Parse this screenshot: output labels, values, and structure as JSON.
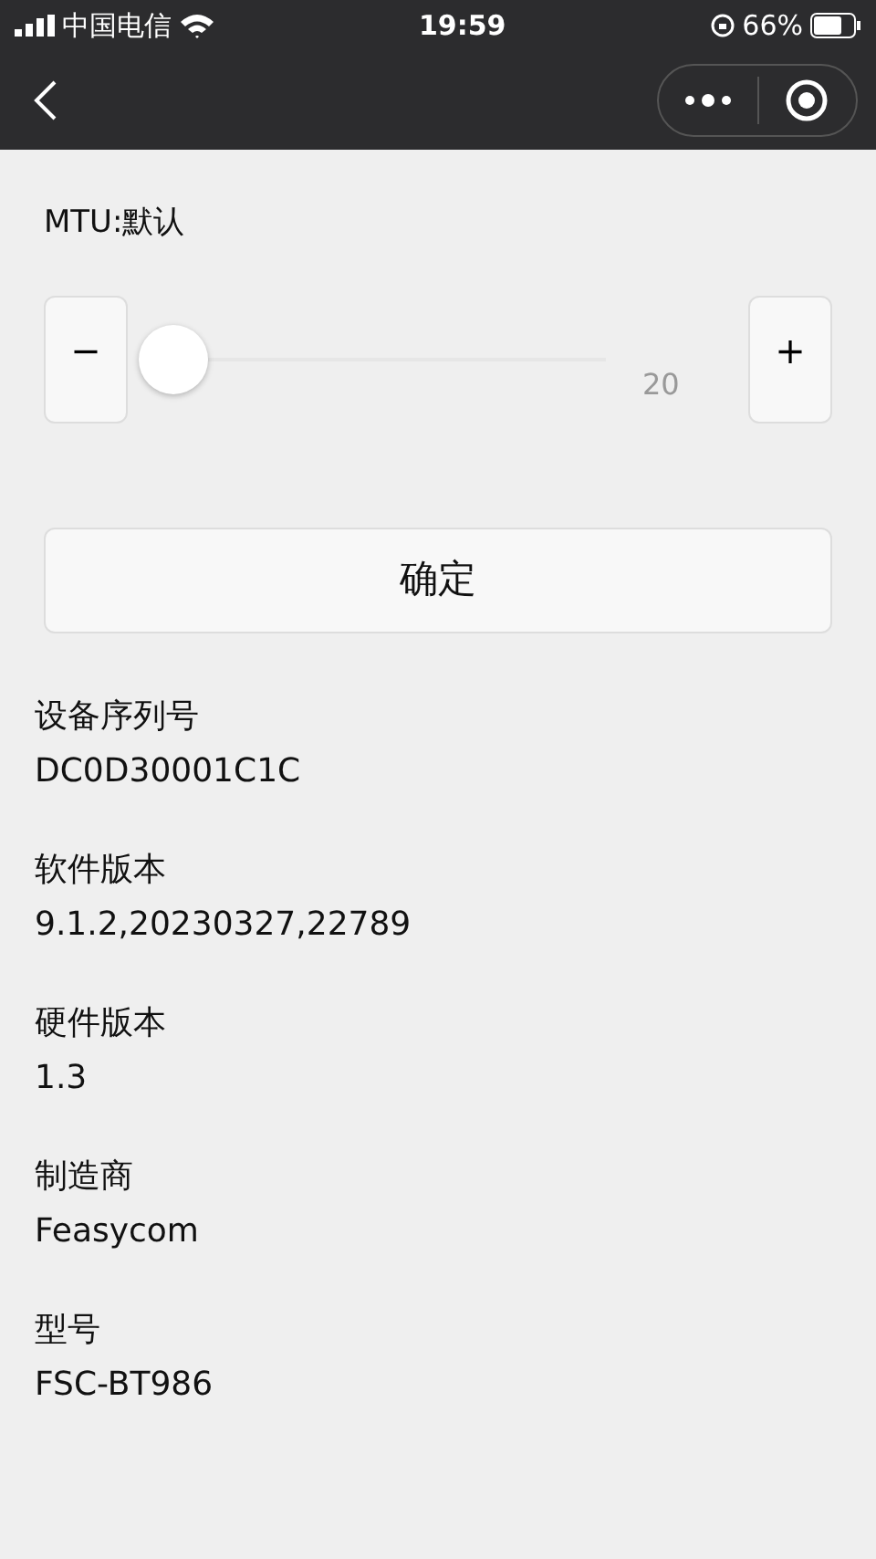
{
  "status_bar": {
    "carrier": "中国电信",
    "time": "19:59",
    "battery": "66%"
  },
  "mtu": {
    "label": "MTU:默认",
    "minus": "−",
    "plus": "+",
    "level": 0,
    "reading": "20"
  },
  "confirm_button": "确定",
  "info": [
    {
      "label": "设备序列号",
      "value": "DC0D30001C1C"
    },
    {
      "label": "软件版本",
      "value": "9.1.2,20230327,22789"
    },
    {
      "label": "硬件版本",
      "value": "1.3"
    },
    {
      "label": "制造商",
      "value": "Feasycom"
    },
    {
      "label": "型号",
      "value": "FSC-BT986"
    }
  ]
}
